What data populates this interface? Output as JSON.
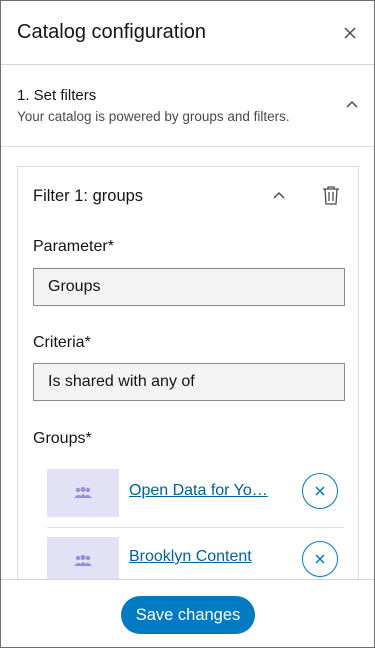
{
  "header": {
    "title": "Catalog configuration",
    "close_icon": "close-icon"
  },
  "section": {
    "title": "1. Set filters",
    "subtitle": "Your catalog is powered by groups and filters.",
    "chevron_icon": "chevron-up-icon"
  },
  "filter": {
    "title": "Filter 1: groups",
    "chevron_icon": "chevron-up-icon",
    "delete_icon": "trash-icon",
    "parameter_label": "Parameter*",
    "parameter_value": "Groups",
    "criteria_label": "Criteria*",
    "criteria_value": "Is shared with any of",
    "groups_label": "Groups*",
    "groups": [
      {
        "name": "Open Data for Yo…",
        "icon": "group-icon"
      },
      {
        "name": "Brooklyn Content",
        "icon": "group-icon"
      }
    ]
  },
  "footer": {
    "save_label": "Save changes"
  },
  "colors": {
    "brand": "#007ac2",
    "link": "#00619b",
    "thumb_bg": "#e3e1f6",
    "thumb_icon": "#9a8fd6"
  }
}
